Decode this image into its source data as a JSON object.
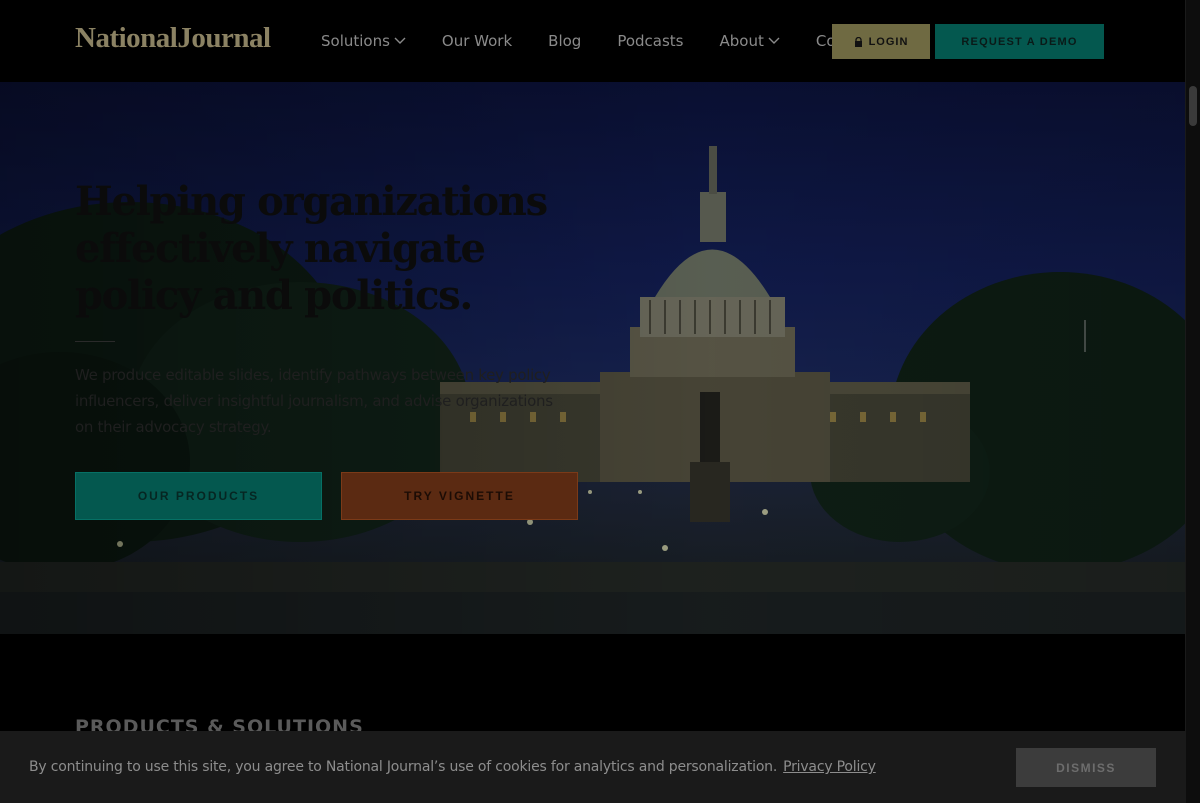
{
  "brand": {
    "logo_text": "NationalJournal",
    "logo_color": "#8b8263"
  },
  "nav": {
    "items": [
      {
        "label": "Solutions",
        "has_dropdown": true
      },
      {
        "label": "Our Work",
        "has_dropdown": false
      },
      {
        "label": "Blog",
        "has_dropdown": false
      },
      {
        "label": "Podcasts",
        "has_dropdown": false
      },
      {
        "label": "About",
        "has_dropdown": true
      },
      {
        "label": "Contact",
        "has_dropdown": false
      }
    ],
    "login_label": "LOGIN",
    "login_icon": "lock-icon",
    "demo_label": "REQUEST A DEMO"
  },
  "hero": {
    "title": "Helping organizations effectively navigate policy and politics.",
    "description": "We produce editable slides, identify pathways between key policy influencers, deliver insightful journalism, and advise organizations on their advocacy strategy.",
    "primary_button": "OUR PRODUCTS",
    "secondary_button": "TRY VIGNETTE",
    "image_alt": "capitol-building-at-night"
  },
  "sections": {
    "products_label": "PRODUCTS & SOLUTIONS"
  },
  "cookie_banner": {
    "message": "By continuing to use this site, you agree to National Journal’s use of cookies for analytics and personalization.",
    "privacy_link": "Privacy Policy",
    "dismiss_label": "DISMISS"
  },
  "colors": {
    "accent_teal": "#04584f",
    "accent_gold": "#6f6a42",
    "accent_rust": "#5b2a12",
    "overlay_bg": "#000000"
  }
}
